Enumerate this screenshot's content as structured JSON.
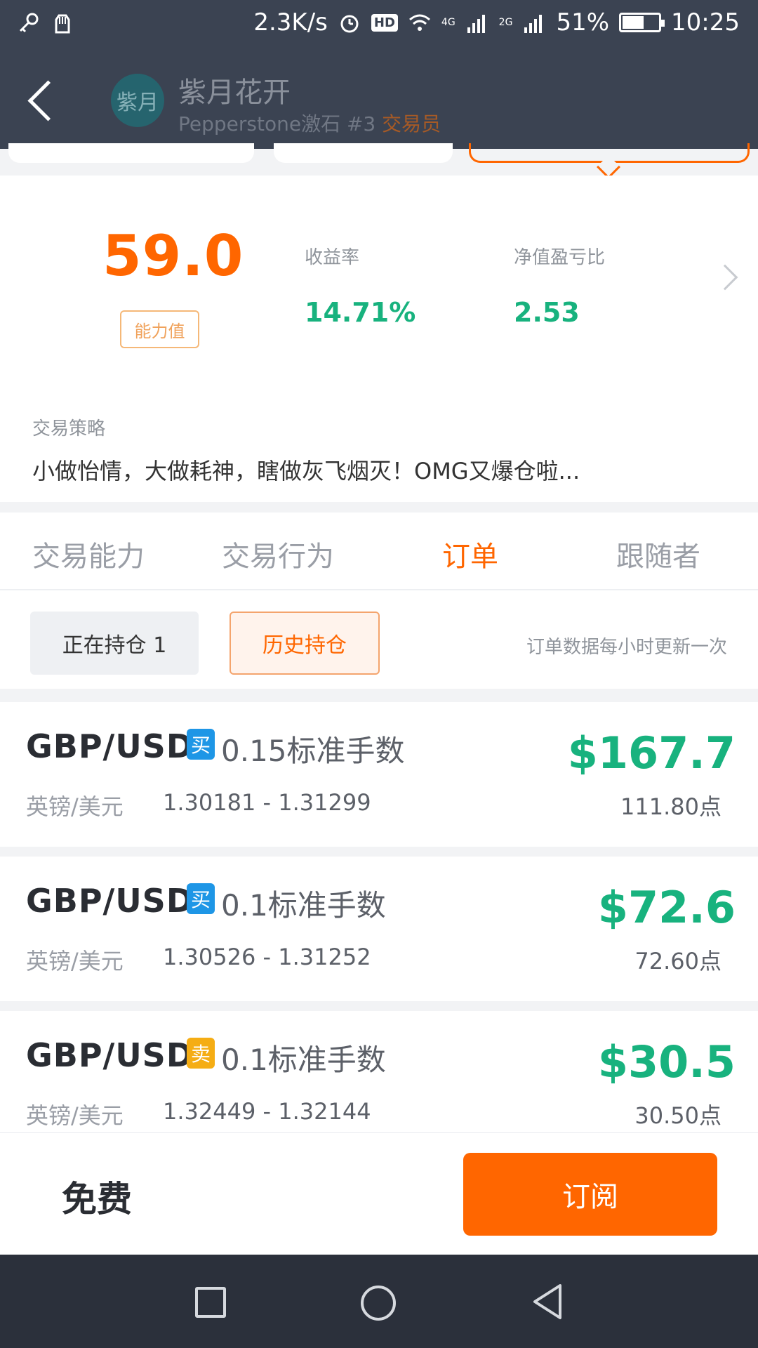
{
  "status_bar": {
    "speed": "2.3K/s",
    "hd": "HD",
    "net1": "4G",
    "net2": "2G",
    "battery": "51%",
    "time": "10:25"
  },
  "header": {
    "avatar_text": "紫月",
    "name": "紫月花开",
    "broker_rank": "Pepperstone激石 #3",
    "role_tag": "交易员"
  },
  "stats": {
    "score": "59.0",
    "score_label": "能力值",
    "return_label": "收益率",
    "return_value": "14.71%",
    "ratio_label": "净值盈亏比",
    "ratio_value": "2.53"
  },
  "strategy": {
    "label": "交易策略",
    "text": "小做怡情，大做耗神，瞎做灰飞烟灭！OMG又爆仓啦..."
  },
  "tabs": [
    {
      "label": "交易能力"
    },
    {
      "label": "交易行为"
    },
    {
      "label": "订单"
    },
    {
      "label": "跟随者"
    }
  ],
  "filters": {
    "holding": "正在持仓 1",
    "history": "历史持仓",
    "note": "订单数据每小时更新一次"
  },
  "orders": [
    {
      "pair": "GBP/USD",
      "side": "买",
      "lots": "0.15标准手数",
      "cn": "英镑/美元",
      "range": "1.30181 - 1.31299",
      "profit": "$167.7",
      "points": "111.80点"
    },
    {
      "pair": "GBP/USD",
      "side": "买",
      "lots": "0.1标准手数",
      "cn": "英镑/美元",
      "range": "1.30526 - 1.31252",
      "profit": "$72.6",
      "points": "72.60点"
    },
    {
      "pair": "GBP/USD",
      "side": "卖",
      "lots": "0.1标准手数",
      "cn": "英镑/美元",
      "range": "1.32449 - 1.32144",
      "profit": "$30.5",
      "points": "30.50点"
    }
  ],
  "bottom": {
    "price": "免费",
    "subscribe": "订阅"
  },
  "colors": {
    "accent": "#ff6600",
    "positive": "#18b27e",
    "buy": "#1e96e6",
    "sell": "#f5ad14",
    "header_bg": "#3b4352"
  }
}
